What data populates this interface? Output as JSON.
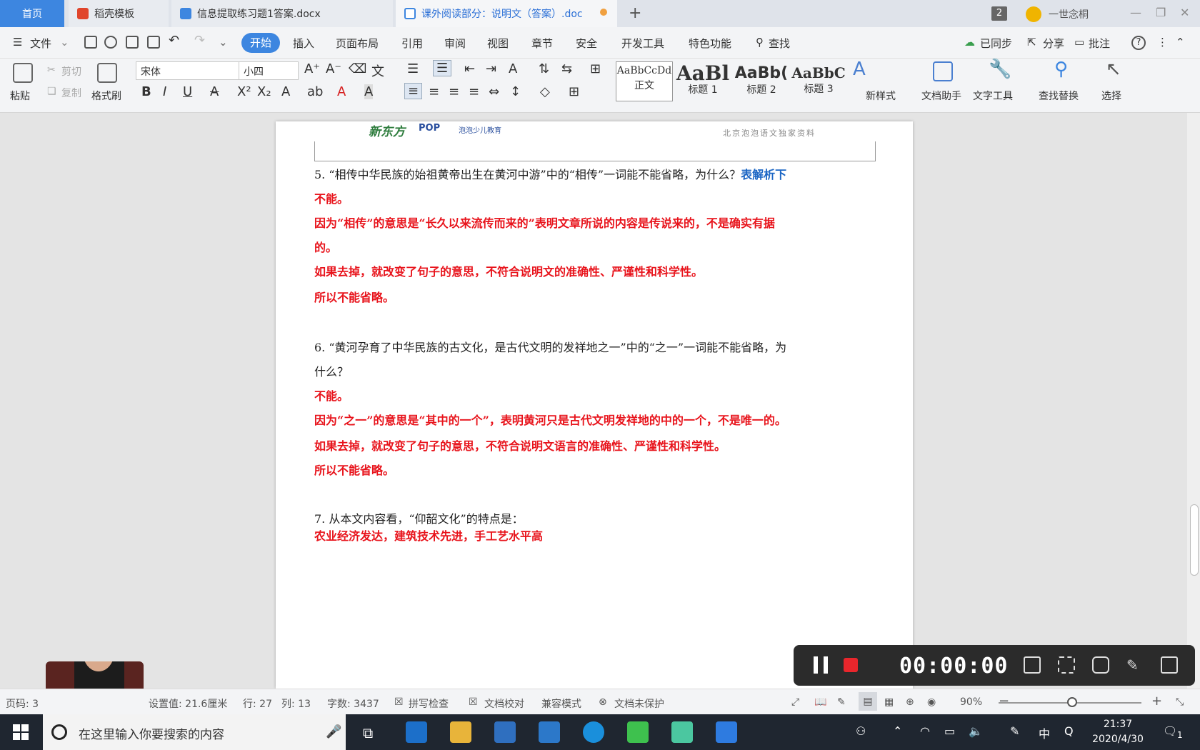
{
  "tabs": {
    "home": "首页",
    "t1": "稻壳模板",
    "t2": "信息提取练习题1答案.docx",
    "t3": "课外阅读部分：说明文（答案）.doc",
    "count": "2",
    "user": "一世念桐"
  },
  "menubar": {
    "file": "文件",
    "start": "开始",
    "items": [
      "插入",
      "页面布局",
      "引用",
      "审阅",
      "视图",
      "章节",
      "安全",
      "开发工具",
      "特色功能"
    ],
    "find": "查找",
    "sync": "已同步",
    "share": "分享",
    "comment": "批注"
  },
  "ribbon": {
    "paste": "粘贴",
    "cut": "剪切",
    "copy": "复制",
    "format_painter": "格式刷",
    "font": "宋体",
    "size": "小四",
    "styles": [
      {
        "sample": "AaBbCcDd",
        "name": "正文"
      },
      {
        "sample": "AaBl",
        "name": "标题 1"
      },
      {
        "sample": "AaBb(",
        "name": "标题 2"
      },
      {
        "sample": "AaBbC",
        "name": "标题 3"
      }
    ],
    "new_style": "新样式",
    "doc_helper": "文档助手",
    "text_tools": "文字工具",
    "find_replace": "查找替换",
    "select": "选择"
  },
  "header": {
    "logo1": "新东方",
    "logo2": "POP",
    "logo2_sub": "泡泡少儿教育",
    "right": "北京泡泡语文独家资料"
  },
  "document": {
    "q5": {
      "question": "5.  “相传中华民族的始祖黄帝出生在黄河中游”中的“相传”一词能不能省略，为什么？",
      "hint": "表解析下",
      "a1": "不能。",
      "a2": "因为“相传”的意思是“长久以来流传而来的”表明文章所说的内容是传说来的，不是确实有据",
      "a2b": "的。",
      "a3": "如果去掉，就改变了句子的意思，不符合说明文的准确性、严谨性和科学性。",
      "a4": "所以不能省略。"
    },
    "q6": {
      "question": "6.  “黄河孕育了中华民族的古文化，是古代文明的发祥地之一”中的“之一”一词能不能省略，为",
      "question_b": "什么？",
      "a1": "不能。",
      "a2": "因为“之一”的意思是“其中的一个”，表明黄河只是古代文明发祥地的中的一个，不是唯一的。",
      "a3": "如果去掉，就改变了句子的意思，不符合说明文语言的准确性、严谨性和科学性。",
      "a4": "所以不能省略。"
    },
    "q7": {
      "question": "7.  从本文内容看，“仰韶文化”的特点是：",
      "answer": "农业经济发达，建筑技术先进，手工艺水平高"
    }
  },
  "recorder": {
    "time": "00:00:00"
  },
  "statusbar": {
    "page": "页码: 3",
    "setting": "设置值: 21.6厘米",
    "row": "行: 27",
    "col": "列: 13",
    "words": "字数: 3437",
    "spell": "拼写检查",
    "proof": "文档校对",
    "compat": "兼容模式",
    "protect": "文档未保护",
    "zoom": "90%"
  },
  "taskbar": {
    "search_placeholder": "在这里输入你要搜索的内容",
    "ime": "中",
    "time": "21:37",
    "date": "2020/4/30",
    "notif": "1"
  }
}
